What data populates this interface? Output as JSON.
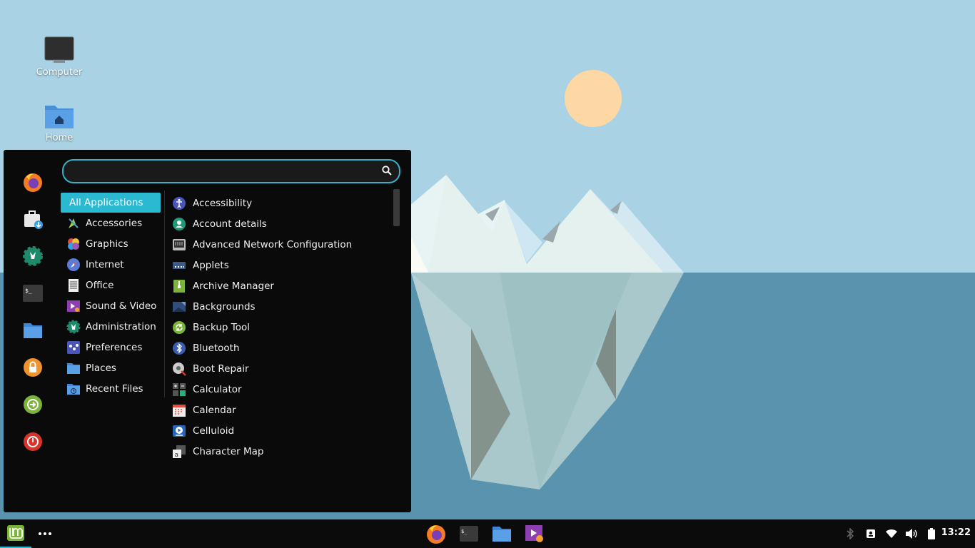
{
  "desktop": {
    "icons": [
      {
        "label": "Computer",
        "icon": "monitor-icon"
      },
      {
        "label": "Home",
        "icon": "home-folder-icon"
      }
    ]
  },
  "menu": {
    "search": {
      "value": "",
      "placeholder": ""
    },
    "favorites": [
      "firefox-icon",
      "software-manager-icon",
      "system-settings-icon",
      "terminal-icon",
      "files-icon",
      "lock-icon",
      "logout-icon",
      "power-icon"
    ],
    "categories": [
      {
        "label": "All Applications",
        "active": true
      },
      {
        "label": "Accessories"
      },
      {
        "label": "Graphics"
      },
      {
        "label": "Internet"
      },
      {
        "label": "Office"
      },
      {
        "label": "Sound & Video"
      },
      {
        "label": "Administration"
      },
      {
        "label": "Preferences"
      },
      {
        "label": "Places"
      },
      {
        "label": "Recent Files"
      }
    ],
    "apps": [
      {
        "label": "Accessibility"
      },
      {
        "label": "Account details"
      },
      {
        "label": "Advanced Network Configuration"
      },
      {
        "label": "Applets"
      },
      {
        "label": "Archive Manager"
      },
      {
        "label": "Backgrounds"
      },
      {
        "label": "Backup Tool"
      },
      {
        "label": "Bluetooth"
      },
      {
        "label": "Boot Repair"
      },
      {
        "label": "Calculator"
      },
      {
        "label": "Calendar"
      },
      {
        "label": "Celluloid"
      },
      {
        "label": "Character Map"
      }
    ]
  },
  "panel": {
    "clock": "13:22",
    "taskbar": [
      "firefox-icon",
      "terminal-icon",
      "files-icon",
      "media-player-icon"
    ],
    "tray": [
      "bluetooth-icon",
      "display-icon",
      "wifi-icon",
      "volume-icon",
      "battery-icon"
    ]
  },
  "colors": {
    "accent": "#2ab9d0",
    "sky": "#a9d3e5",
    "sea": "#5a93ae",
    "sun": "#fdd8a4"
  }
}
